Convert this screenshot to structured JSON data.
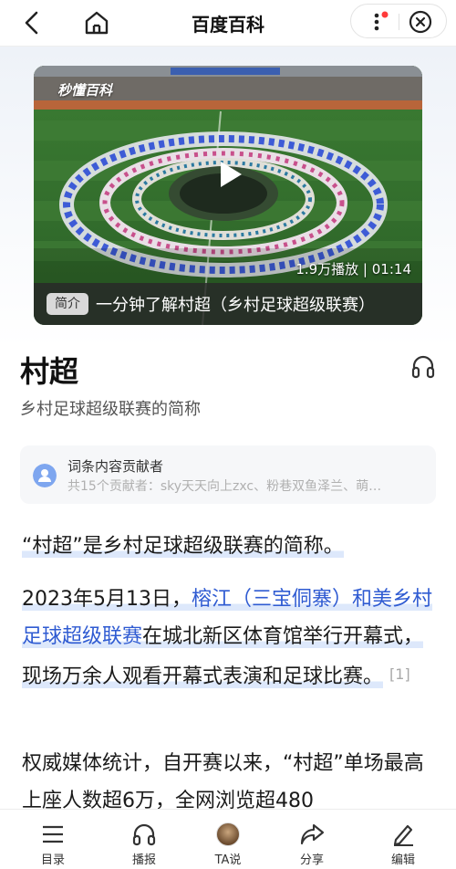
{
  "nav": {
    "title": "百度百科",
    "back_icon": "back-arrow-icon",
    "home_icon": "home-icon",
    "more_icon": "more-vertical-icon",
    "close_icon": "close-circle-icon",
    "notify_color": "#ff3b3b"
  },
  "video": {
    "brand": "秒懂百科",
    "stats": "1.9万播放 | 01:14",
    "tag": "简介",
    "caption": "一分钟了解村超（乡村足球超级联赛）"
  },
  "entry": {
    "title": "村超",
    "subtitle": "乡村足球超级联赛的简称",
    "listen_icon": "headphones-icon"
  },
  "contributors": {
    "title": "词条内容贡献者",
    "desc": "共15个贡献者：sky天天向上zxc、粉巷双鱼泽兰、萌…"
  },
  "body": {
    "p1": "“村超”是乡村足球超级联赛的简称。",
    "p2_pre": "2023年5月13日，",
    "p2_link": "榕江（三宝侗寨）和美乡村足球超级联赛",
    "p2_post": "在城北新区体育馆举行开幕式，现场万余人观看开幕式表演和足球比赛。",
    "p2_ref": "[1]",
    "p3": "权威媒体统计，自开赛以来，“村超”单场最高上座人数超6万，全网浏览超480"
  },
  "bottom_tabs": [
    {
      "label": "目录",
      "icon": "list-icon"
    },
    {
      "label": "播报",
      "icon": "headphones-icon"
    },
    {
      "label": "TA说",
      "icon": "avatar-icon"
    },
    {
      "label": "分享",
      "icon": "share-icon"
    },
    {
      "label": "编辑",
      "icon": "edit-icon"
    }
  ],
  "colors": {
    "link": "#2f5bd2",
    "highlight": "#dde8fb"
  }
}
